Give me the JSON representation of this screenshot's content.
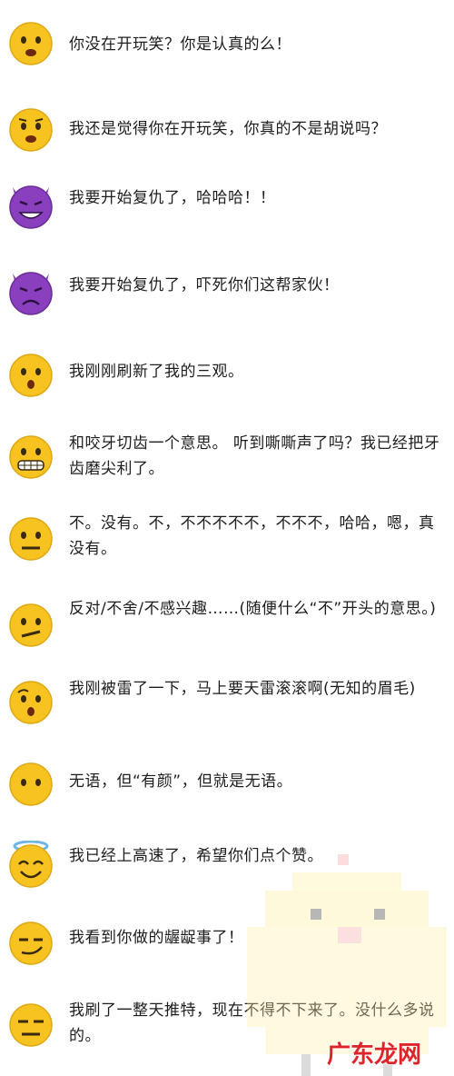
{
  "entries": [
    {
      "emoji": "frowning-open-mouth-face",
      "text": "你没在开玩笑？你是认真的么！"
    },
    {
      "emoji": "anguished-face",
      "text": "我还是觉得你在开玩笑，你真的不是胡说吗？"
    },
    {
      "emoji": "smiling-imp-face",
      "text": "我要开始复仇了，哈哈哈！！"
    },
    {
      "emoji": "angry-imp-face",
      "text": "我要开始复仇了，吓死你们这帮家伙！"
    },
    {
      "emoji": "hushed-face",
      "text": "我刚刚刷新了我的三观。"
    },
    {
      "emoji": "grimacing-face",
      "text": "和咬牙切齿一个意思。 听到嘶嘶声了吗？我已经把牙齿磨尖利了。"
    },
    {
      "emoji": "neutral-face",
      "text": "不。没有。不，不不不不不，不不不，哈哈，嗯，真没有。"
    },
    {
      "emoji": "confused-face",
      "text": "反对/不舍/不感兴趣……(随便什么“不”开头的意思。)"
    },
    {
      "emoji": "astonished-face",
      "text": "我刚被雷了一下，马上要天雷滚滚啊(无知的眉毛)"
    },
    {
      "emoji": "no-mouth-face",
      "text": "无语，但“有颜”，但就是无语。"
    },
    {
      "emoji": "halo-smiling-face",
      "text": "我已经上高速了，希望你们点个赞。"
    },
    {
      "emoji": "smirking-face",
      "text": "我看到你做的龌龊事了！"
    },
    {
      "emoji": "expressionless-face",
      "text": "我刷了一整天推特，现在不得不下来了。没什么多说的。"
    }
  ],
  "watermark": {
    "text": "广东龙网",
    "icon": "pixel-chick-watermark"
  },
  "colors": {
    "face": "#f7c321",
    "face_edge": "#e0a814",
    "imp": "#8a3fbf",
    "text": "#1d1d1d",
    "watermark": "#e0232b"
  }
}
